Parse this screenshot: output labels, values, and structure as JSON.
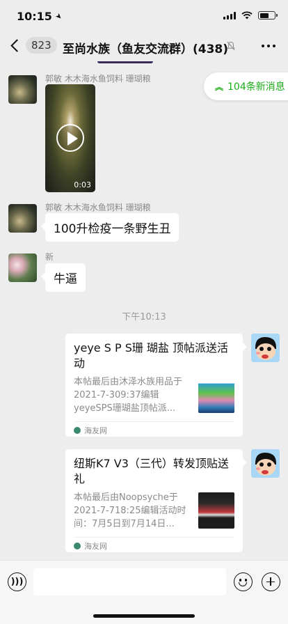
{
  "status_bar": {
    "time": "10:15",
    "location_icon": "location-arrow-icon",
    "icons": [
      "signal-icon",
      "wifi-icon",
      "battery-icon"
    ]
  },
  "nav": {
    "back_count": "823",
    "title": "至尚水族（鱼友交流群）(438)",
    "mute_icon": "bell-off-icon",
    "more_icon": "more-icon"
  },
  "new_messages": {
    "label": "104条新消息"
  },
  "messages": [
    {
      "sender": "郭敏 木木海水鱼饲料 珊瑚粮",
      "type": "video",
      "duration": "0:03"
    },
    {
      "sender": "郭敏 木木海水鱼饲料 珊瑚粮",
      "type": "text",
      "text": "100升检疫一条野生丑"
    },
    {
      "sender": "新",
      "type": "text",
      "text": "牛逼"
    }
  ],
  "timestamp": "下午10:13",
  "cards": [
    {
      "title": "yeye S P S珊 瑚盐 顶帖派送活动",
      "desc": "本帖最后由沐泽水族用品于2021-7-309:37编辑 yeyeSPS珊瑚盐顶帖派...",
      "source": "海友网"
    },
    {
      "title": "纽斯K7 V3（三代）转发顶贴送礼",
      "desc": "本帖最后由Noopsyche于2021-7-718:25编辑活动时间：7月5日到7月14日...",
      "source": "海友网"
    }
  ],
  "input": {
    "value": ""
  }
}
